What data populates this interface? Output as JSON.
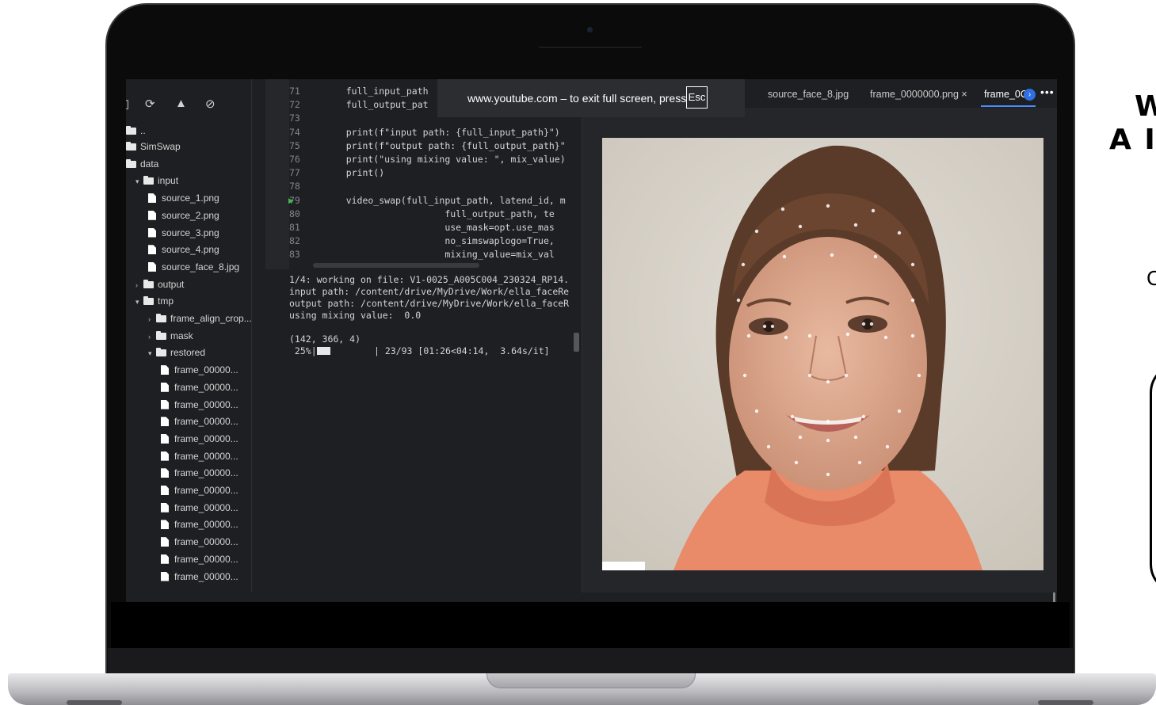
{
  "fullscreen_toast": {
    "text": "www.youtube.com – to exit full screen, press",
    "key": "Esc"
  },
  "explorer": {
    "parent": "..",
    "items": [
      {
        "label": "SimSwap",
        "type": "folder"
      },
      {
        "label": "data",
        "type": "folder"
      },
      {
        "label": "input",
        "type": "folder"
      },
      {
        "label": "source_1.png",
        "type": "file"
      },
      {
        "label": "source_2.png",
        "type": "file"
      },
      {
        "label": "source_3.png",
        "type": "file"
      },
      {
        "label": "source_4.png",
        "type": "file"
      },
      {
        "label": "source_face_8.jpg",
        "type": "file"
      },
      {
        "label": "output",
        "type": "folder"
      },
      {
        "label": "tmp",
        "type": "folder"
      },
      {
        "label": "frame_align_crop...",
        "type": "folder"
      },
      {
        "label": "mask",
        "type": "folder"
      },
      {
        "label": "restored",
        "type": "folder"
      },
      {
        "label": "frame_00000...",
        "type": "file"
      },
      {
        "label": "frame_00000...",
        "type": "file"
      },
      {
        "label": "frame_00000...",
        "type": "file"
      },
      {
        "label": "frame_00000...",
        "type": "file"
      },
      {
        "label": "frame_00000...",
        "type": "file"
      },
      {
        "label": "frame_00000...",
        "type": "file"
      },
      {
        "label": "frame_00000...",
        "type": "file"
      },
      {
        "label": "frame_00000...",
        "type": "file"
      },
      {
        "label": "frame_00000...",
        "type": "file"
      },
      {
        "label": "frame_00000...",
        "type": "file"
      },
      {
        "label": "frame_00000...",
        "type": "file"
      },
      {
        "label": "frame_00000...",
        "type": "file"
      },
      {
        "label": "frame_00000...",
        "type": "file"
      }
    ]
  },
  "code": {
    "lines": [
      {
        "n": "71",
        "text": "    full_input_path"
      },
      {
        "n": "72",
        "text": "    full_output_pat"
      },
      {
        "n": "73",
        "text": ""
      },
      {
        "n": "74",
        "text": "    print(f\"input path: {full_input_path}\")"
      },
      {
        "n": "75",
        "text": "    print(f\"output path: {full_output_path}\""
      },
      {
        "n": "76",
        "text": "    print(\"using mixing value: \", mix_value)"
      },
      {
        "n": "77",
        "text": "    print()"
      },
      {
        "n": "78",
        "text": ""
      },
      {
        "n": "79",
        "text": "    video_swap(full_input_path, latend_id, m"
      },
      {
        "n": "80",
        "text": "                      full_output_path, te"
      },
      {
        "n": "81",
        "text": "                      use_mask=opt.use_mas"
      },
      {
        "n": "82",
        "text": "                      no_simswaplogo=True,"
      },
      {
        "n": "83",
        "text": "                      mixing_value=mix_val"
      }
    ]
  },
  "output": {
    "line1": "1/4: working on file: V1-0025_A005C004_230324_RP14.",
    "line2": "input path: /content/drive/MyDrive/Work/ella_faceRe",
    "line3": "output path: /content/drive/MyDrive/Work/ella_faceR",
    "line4": "using mixing value:  0.0",
    "line5": "(142, 366, 4)",
    "progress_pct": " 25%|",
    "progress_fraction": 0.25,
    "progress_rest": "        | 23/93 [01:26<04:14,  3.64s/it]"
  },
  "tabs": {
    "tab1": "source_face_8.jpg",
    "tab2": "frame_0000000.png",
    "tab2_close": "×",
    "tab3": "frame_0C",
    "arrow": "›",
    "more": "•••"
  },
  "side_slide": {
    "heading_line1": "W",
    "heading_line2": "A I",
    "letter": "C"
  },
  "colors": {
    "accent": "#4a8ff7",
    "editor_bg": "#1e1f22",
    "string": "#ce9178",
    "keyword": "#569cd6"
  }
}
